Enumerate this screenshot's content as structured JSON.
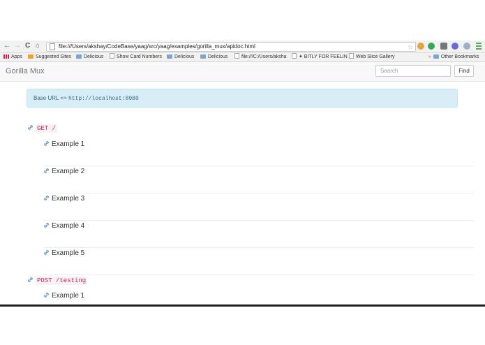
{
  "browser": {
    "url": "file:///Users/akshay/CodeBase/yaag/src/yaag/examples/gorilla_mux/apidoc.html",
    "nav": {
      "back": "←",
      "forward": "→",
      "reload": "C",
      "home": "⌂"
    },
    "bookmarks": [
      {
        "label": "Apps",
        "icon": "apps-icon"
      },
      {
        "label": "Suggested Sites",
        "icon": "suggested-sites-icon"
      },
      {
        "label": "Delicious",
        "icon": "folder-icon"
      },
      {
        "label": "Show Card Numbers",
        "icon": "page-icon"
      },
      {
        "label": "Delicious",
        "icon": "folder-icon"
      },
      {
        "label": "Delicious",
        "icon": "folder-icon"
      },
      {
        "label": "file:///C:/Users/aksha",
        "icon": "page-icon"
      },
      {
        "label": "✦ BITLY FOR FEELIN",
        "icon": "page-icon"
      },
      {
        "label": "Web Slice Gallery",
        "icon": "page-icon"
      }
    ],
    "other_bookmarks": "Other Bookmarks"
  },
  "app": {
    "brand": "Gorilla Mux",
    "search_placeholder": "Search",
    "find_label": "Find",
    "base_url_label": "Base URL =>",
    "base_url": "http://localhost:8080"
  },
  "endpoints": [
    {
      "label": "GET /",
      "examples": [
        "Example 1",
        "Example 2",
        "Example 3",
        "Example 4",
        "Example 5"
      ]
    },
    {
      "label": "POST /testing",
      "examples": [
        "Example 1"
      ]
    }
  ],
  "colors": {
    "accent": "#337ab7",
    "alert_bg": "#d9edf7",
    "code": "#c7254e"
  }
}
